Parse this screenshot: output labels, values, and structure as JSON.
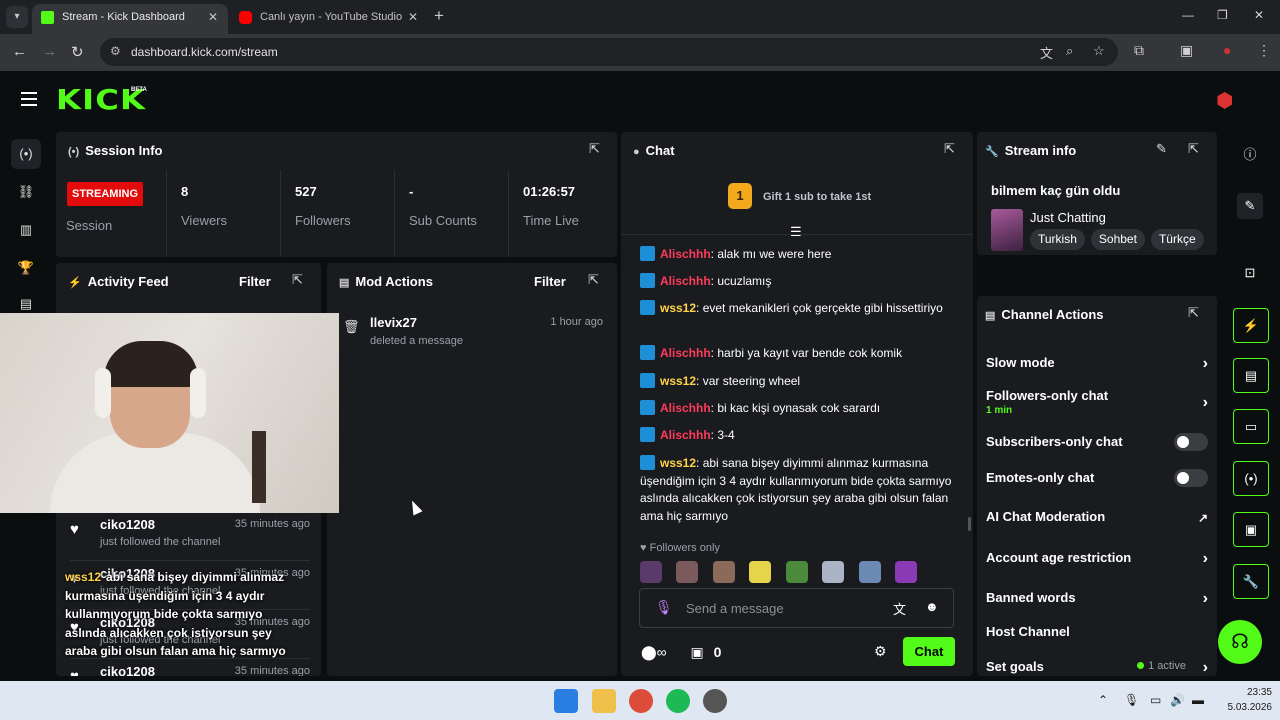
{
  "browser": {
    "tabs": [
      {
        "label": "Stream - Kick Dashboard",
        "fav_color": "#53fc18"
      },
      {
        "label": "Canlı yayın - YouTube Studio",
        "fav_color": "#ff0000"
      }
    ],
    "url": "dashboard.kick.com/stream"
  },
  "kick": {
    "logo": "KICK",
    "beta": "BETA"
  },
  "session": {
    "title": "Session Info",
    "badge": "STREAMING",
    "badge_label": "Session",
    "stats": [
      {
        "value": "8",
        "label": "Viewers"
      },
      {
        "value": "527",
        "label": "Followers"
      },
      {
        "value": "-",
        "label": "Sub Counts"
      },
      {
        "value": "01:26:57",
        "label": "Time Live"
      }
    ]
  },
  "activity": {
    "title": "Activity Feed",
    "filter": "Filter",
    "items": [
      {
        "name": "ciko1208",
        "time": "35 minutes ago",
        "desc": "just followed the channel"
      },
      {
        "name": "ciko1208",
        "time": "35 minutes ago",
        "desc": "just followed the channel"
      },
      {
        "name": "ciko1208",
        "time": "35 minutes ago",
        "desc": "just followed the channel"
      },
      {
        "name": "ciko1208",
        "time": "35 minutes ago",
        "desc": ""
      }
    ]
  },
  "overlay": {
    "name": "wss12",
    "text": "abi sana bişey diyimmi alınmaz kurmasına üşendiğim için 3 4 aydır kullanmıyorum bide çokta sarmıyo aslında alıcakken çok istiyorsun şey araba gibi olsun falan ama hiç sarmıyo"
  },
  "mod": {
    "title": "Mod Actions",
    "filter": "Filter",
    "item": {
      "name": "llevix27",
      "time": "1 hour ago",
      "desc": "deleted a message"
    }
  },
  "chat": {
    "title": "Chat",
    "gift_number": "1",
    "gift_text": "Gift 1 sub to take 1st",
    "messages": [
      {
        "user": "Alischhh",
        "color": "#ff3b5c",
        "text": "alak mı we were here"
      },
      {
        "user": "Alischhh",
        "color": "#ff3b5c",
        "text": "ucuzlamış"
      },
      {
        "user": "wss12",
        "color": "#ffd447",
        "text": "evet mekanikleri çok gerçekte gibi hissettiriyo"
      },
      {
        "user": "Alischhh",
        "color": "#ff3b5c",
        "text": "harbi ya kayıt var bende cok komik"
      },
      {
        "user": "wss12",
        "color": "#ffd447",
        "text": "var steering wheel"
      },
      {
        "user": "Alischhh",
        "color": "#ff3b5c",
        "text": "bi kac kişi oynasak cok sarardı"
      },
      {
        "user": "Alischhh",
        "color": "#ff3b5c",
        "text": "3-4"
      },
      {
        "user": "wss12",
        "color": "#ffd447",
        "text": "abi sana bişey diyimmi alınmaz kurmasına üşendiğim için 3 4 aydır kullanmıyorum bide çokta sarmıyo aslında alıcakken çok istiyorsun şey araba gibi olsun falan ama hiç sarmıyo"
      }
    ],
    "followers_only": "Followers only",
    "placeholder": "Send a message",
    "points": "0",
    "send": "Chat"
  },
  "stream_info": {
    "title": "Stream info",
    "stream_title": "bilmem kaç gün oldu",
    "category": "Just Chatting",
    "tags": [
      "Turkish",
      "Sohbet",
      "Türkçe"
    ]
  },
  "channel_actions": {
    "title": "Channel Actions",
    "slow_mode": "Slow mode",
    "followers_only": "Followers-only chat",
    "followers_only_sub": "1 min",
    "subscribers_only": "Subscribers-only chat",
    "emotes_only": "Emotes-only chat",
    "ai_moderation": "AI Chat Moderation",
    "account_age": "Account age restriction",
    "banned_words": "Banned words",
    "host_channel": "Host Channel",
    "set_goals": "Set goals",
    "active": "1 active"
  },
  "taskbar": {
    "time": "23:35",
    "date": "5.03.2026"
  }
}
